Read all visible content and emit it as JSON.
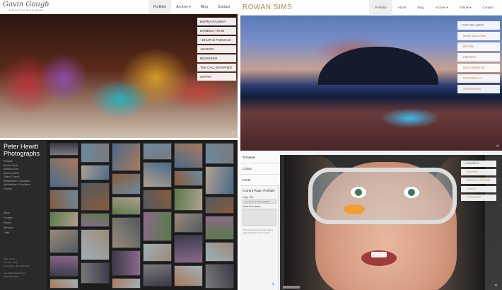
{
  "panel1": {
    "logo_main": "Gavin Gough",
    "logo_sub": "PHOTOGRAPHER",
    "nav": [
      "Portfolio",
      "Archive ▾",
      "Blog",
      "Contact"
    ],
    "menu": [
      "BURMA RAILWAY",
      "BAMBOO TRAIN",
      "BHUTAN TSECHUS",
      "ANGKOR",
      "BUDDHISM",
      "THE CALLIGRAPHER",
      "SAFARI"
    ],
    "menu_prefix": "‹"
  },
  "panel2": {
    "brand": "ROWAN SIMS",
    "nav": [
      "Portfolio",
      "About",
      "Blog",
      "Archive ▾",
      "Follow ▾",
      "Contact"
    ],
    "menu_head": "‹  TOP SELLERS",
    "menu": [
      "NEW ZEALAND",
      "BRAZIL",
      "MEXICO",
      "MOZAMBIQUE",
      "GUATEMALA",
      "AUSTRALIA"
    ]
  },
  "panel3": {
    "title_line1": "Peter Hewitt",
    "title_line2": "Photographs",
    "links": [
      "Portfolio",
      "Recent Work",
      "America East",
      "America West",
      "Cities & Travel",
      "Architecture & Sculpture",
      "Architecture & Sculpture",
      "Flowers"
    ],
    "links2": [
      "About",
      "Contact",
      "Shows",
      "Services",
      "Links"
    ],
    "contact": [
      "Peter Hewitt",
      "P.O. Box 1234",
      "Somewhere, ST 12345-1217",
      "",
      "peter@peterhewitt.com",
      "(555) 555-0155"
    ]
  },
  "panel4": {
    "sections": [
      "Template",
      "Colors",
      "Fonts"
    ],
    "chevron": "›",
    "current_page": "Current Page: Portfolio",
    "page_title_label": "Page Title",
    "page_title_value": "Jenni Chrzen Photography",
    "meta_label": "Meta Description",
    "hint": "Click a pencil icon on the right to make changes to the content",
    "edit_icon": "✎",
    "menu_head": "‹  CONCEPTS",
    "menu": [
      "FASHION",
      "SPORTS & FITNESS",
      "DANCE",
      "PORTRAITS"
    ]
  },
  "share_icon": "⋖"
}
